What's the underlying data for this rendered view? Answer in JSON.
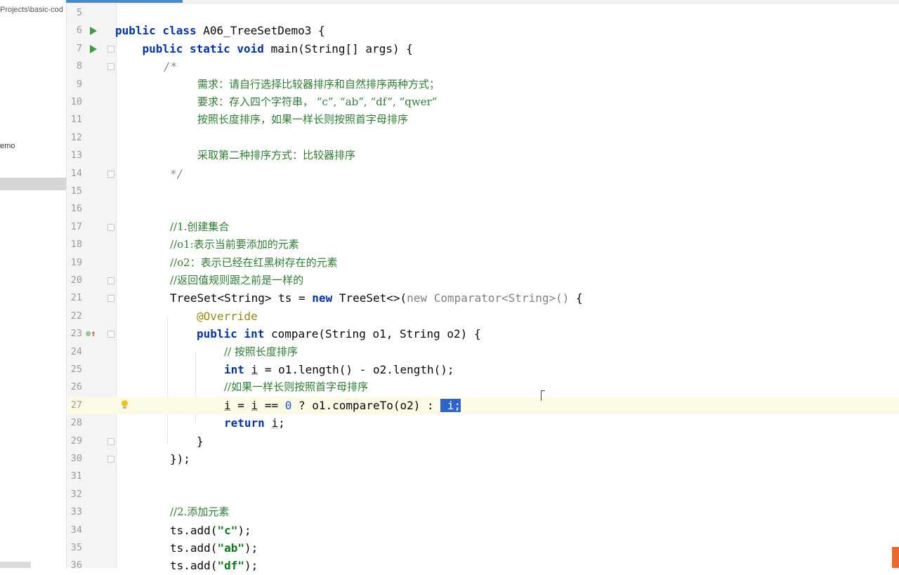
{
  "project": {
    "path_label": "Projects\\basic-cod",
    "file_label": "emo"
  },
  "editor": {
    "class_name": "A06_TreeSetDemo3",
    "method_name": "main",
    "current_line": 27,
    "lines": [
      {
        "n": "5",
        "text": ""
      },
      {
        "n": "6",
        "text": "public class A06_TreeSetDemo3 {"
      },
      {
        "n": "7",
        "text": "public static void main(String[] args) {"
      },
      {
        "n": "8",
        "text": "/*"
      },
      {
        "n": "9",
        "text": "需求：请自行选择比较器排序和自然排序两种方式；"
      },
      {
        "n": "10",
        "text": "要求：存入四个字符串， “c”, “ab”, “df”, “qwer”"
      },
      {
        "n": "11",
        "text": "按照长度排序，如果一样长则按照首字母排序"
      },
      {
        "n": "12",
        "text": ""
      },
      {
        "n": "13",
        "text": "采取第二种排序方式：比较器排序"
      },
      {
        "n": "14",
        "text": "*/"
      },
      {
        "n": "15",
        "text": ""
      },
      {
        "n": "16",
        "text": ""
      },
      {
        "n": "17",
        "text": "//1.创建集合"
      },
      {
        "n": "18",
        "text": "//o1:表示当前要添加的元素"
      },
      {
        "n": "19",
        "text": "//o2：表示已经在红黑树存在的元素"
      },
      {
        "n": "20",
        "text": "//返回值规则跟之前是一样的"
      },
      {
        "n": "21",
        "text": "TreeSet<String> ts = new TreeSet<>(new Comparator<String>() {"
      },
      {
        "n": "22",
        "text": "@Override"
      },
      {
        "n": "23",
        "text": "public int compare(String o1, String o2) {"
      },
      {
        "n": "24",
        "text": "// 按照长度排序"
      },
      {
        "n": "25",
        "text": "int i = o1.length() - o2.length();"
      },
      {
        "n": "26",
        "text": "//如果一样长则按照首字母排序"
      },
      {
        "n": "27",
        "text": "i = i == 0 ? o1.compareTo(o2) : i;"
      },
      {
        "n": "28",
        "text": "return i;"
      },
      {
        "n": "29",
        "text": "}"
      },
      {
        "n": "30",
        "text": "});"
      },
      {
        "n": "31",
        "text": ""
      },
      {
        "n": "32",
        "text": ""
      },
      {
        "n": "33",
        "text": "//2.添加元素"
      },
      {
        "n": "34",
        "text": "ts.add(\"c\");"
      },
      {
        "n": "35",
        "text": "ts.add(\"ab\");"
      },
      {
        "n": "36",
        "text": "ts.add(\"df\");"
      }
    ]
  },
  "colors": {
    "keyword": "#0033b3",
    "comment_cn": "#2e7d32",
    "annotation": "#9e880d",
    "string": "#067d17",
    "number": "#1750eb",
    "selection": "#2f65ca",
    "current_line_bg": "#fdfbe6",
    "run_icon": "#3f9a48"
  },
  "icons": {
    "run": "run-gutter-icon",
    "fold": "fold-marker-icon",
    "override": "override-method-icon",
    "intention": "lightbulb-icon"
  }
}
